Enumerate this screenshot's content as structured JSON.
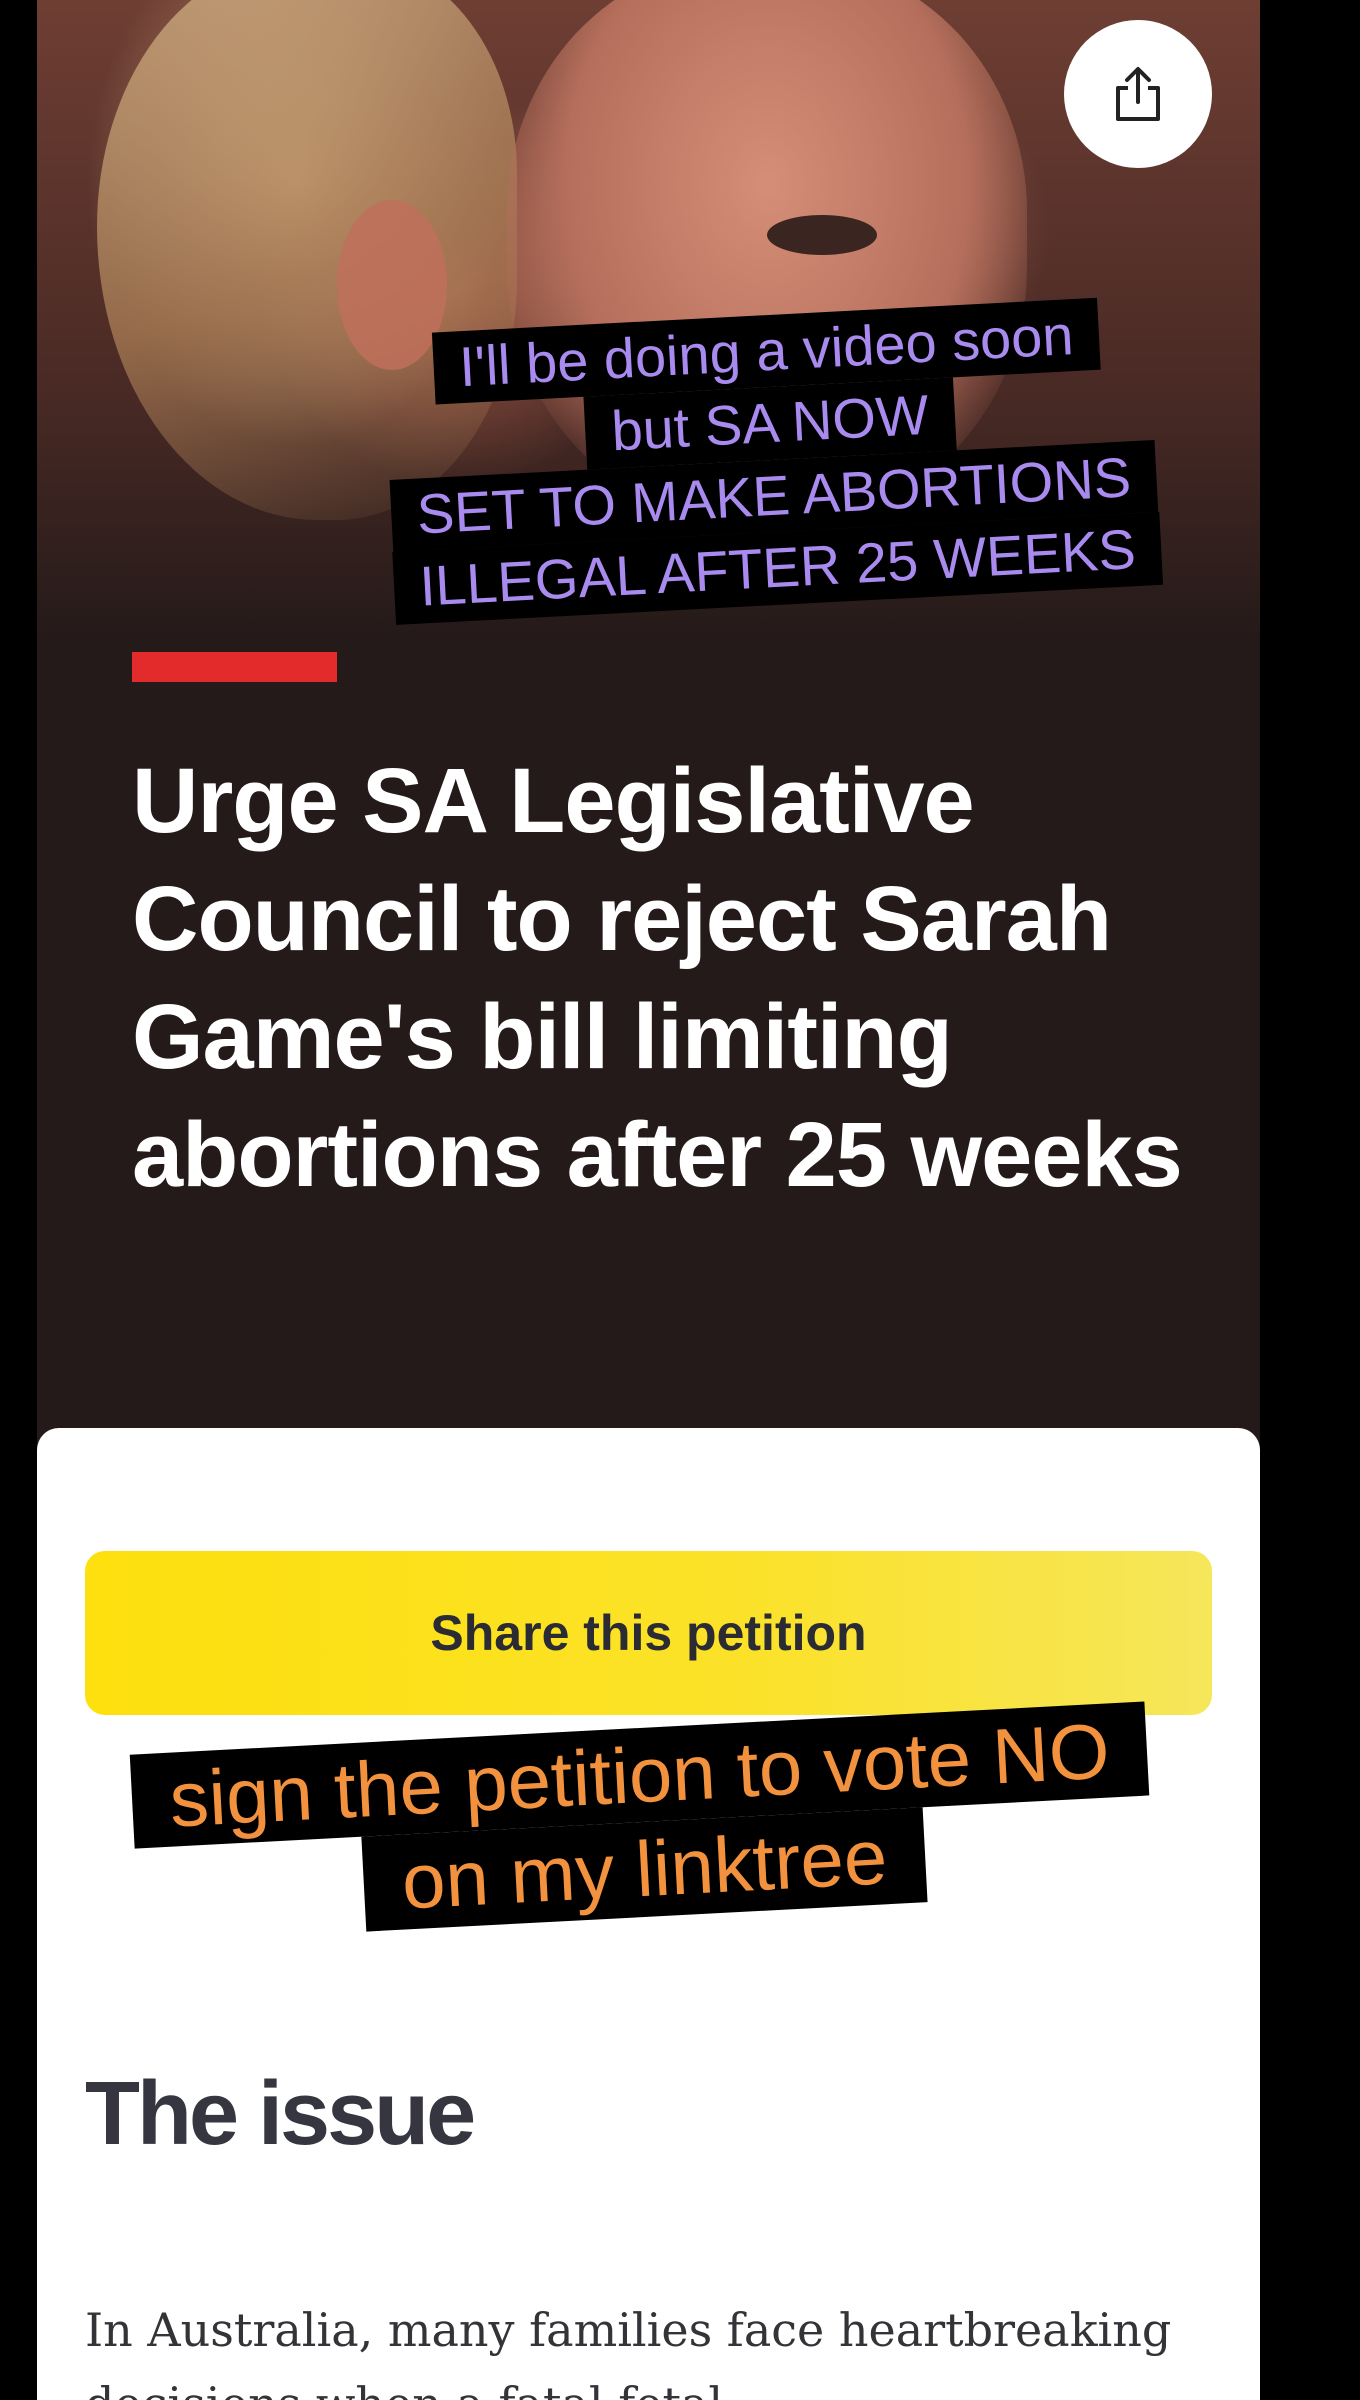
{
  "hero": {
    "overlay_lines": [
      "I'll be doing a video soon",
      "but SA NOW",
      "SET TO MAKE ABORTIONS",
      "ILLEGAL AFTER 25 WEEKS"
    ],
    "share_icon": "share-icon"
  },
  "petition": {
    "title": "Urge SA Legislative Council to reject Sarah Game's bill limiting abortions after 25 weeks",
    "share_button_label": "Share this petition",
    "overlay_lines": [
      "sign the petition to vote NO",
      "on my linktree"
    ],
    "issue_heading": "The issue",
    "issue_text": "In Australia, many families face heartbreaking decisions when a fatal fetal"
  },
  "colors": {
    "accent_red": "#e32b2b",
    "share_yellow": "#fde00d",
    "overlay_purple": "#a98bf0",
    "overlay_orange": "#f3923e",
    "header_background": "#241a19"
  }
}
